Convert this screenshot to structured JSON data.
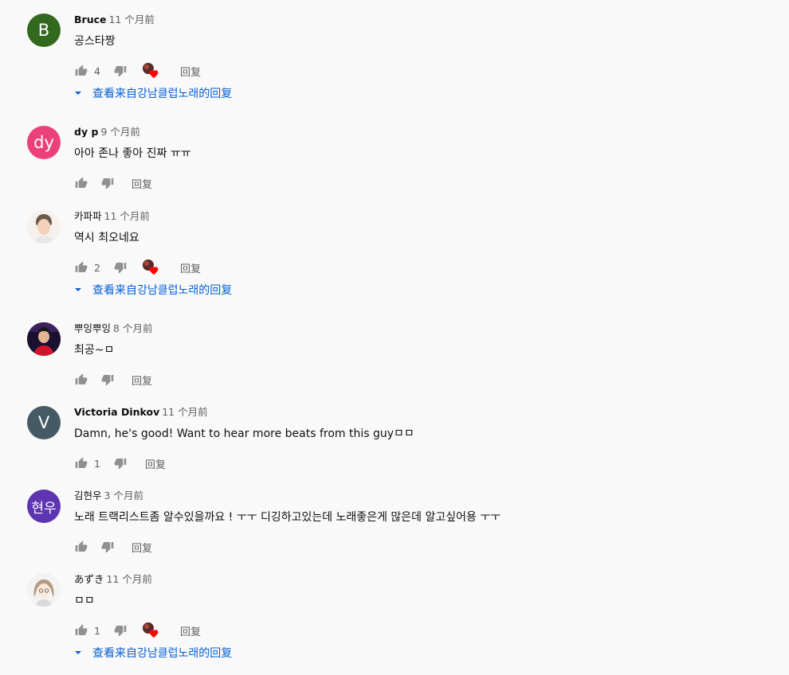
{
  "ui": {
    "reply_label": "回复",
    "view_replies_label": "查看来自강남클럽노래的回复"
  },
  "colors": {
    "link": "#065fd4",
    "secondary_text": "#606060",
    "heart": "#ff0000"
  },
  "comments": [
    {
      "author": "Bruce",
      "time": "11 个月前",
      "text": "공스타짱",
      "likes": "4",
      "avatar_letter": "B",
      "avatar_color": "#33691e",
      "hearted": true,
      "has_replies": true
    },
    {
      "author": "dy p",
      "time": "9 个月前",
      "text": "아아 존나 좋아 진짜 ㅠㅠ",
      "likes": "",
      "avatar_letter": "dy",
      "avatar_color": "#ec407a",
      "hearted": false,
      "has_replies": false
    },
    {
      "author": "카파파",
      "time": "11 个月前",
      "text": "역시 최오네요",
      "likes": "2",
      "avatar_letter": "",
      "avatar_color": "#f0e0d0",
      "hearted": true,
      "has_replies": true
    },
    {
      "author": "뿌잉뿌잉",
      "time": "8 个月前",
      "text": "최공~ㅁ",
      "likes": "",
      "avatar_letter": "",
      "avatar_color": "#b0162b",
      "hearted": false,
      "has_replies": false
    },
    {
      "author": "Victoria Dinkov",
      "time": "11 个月前",
      "text": "Damn, he's good! Want to hear more beats from this guyㅁㅁ",
      "likes": "1",
      "avatar_letter": "V",
      "avatar_color": "#455a64",
      "hearted": false,
      "has_replies": false
    },
    {
      "author": "김현우",
      "time": "3 个月前",
      "text": "노래 트랙리스트좀 알수있을까요 ! ㅜㅜ 디깅하고있는데 노래좋은게 많은데 알고싶어용 ㅜㅜ",
      "likes": "",
      "avatar_letter": "현우",
      "avatar_color": "#5e35b1",
      "hearted": false,
      "has_replies": false
    },
    {
      "author": "あずき",
      "time": "11 个月前",
      "text": "ㅁㅁ",
      "likes": "1",
      "avatar_letter": "",
      "avatar_color": "#eeeeee",
      "hearted": true,
      "has_replies": true
    }
  ]
}
